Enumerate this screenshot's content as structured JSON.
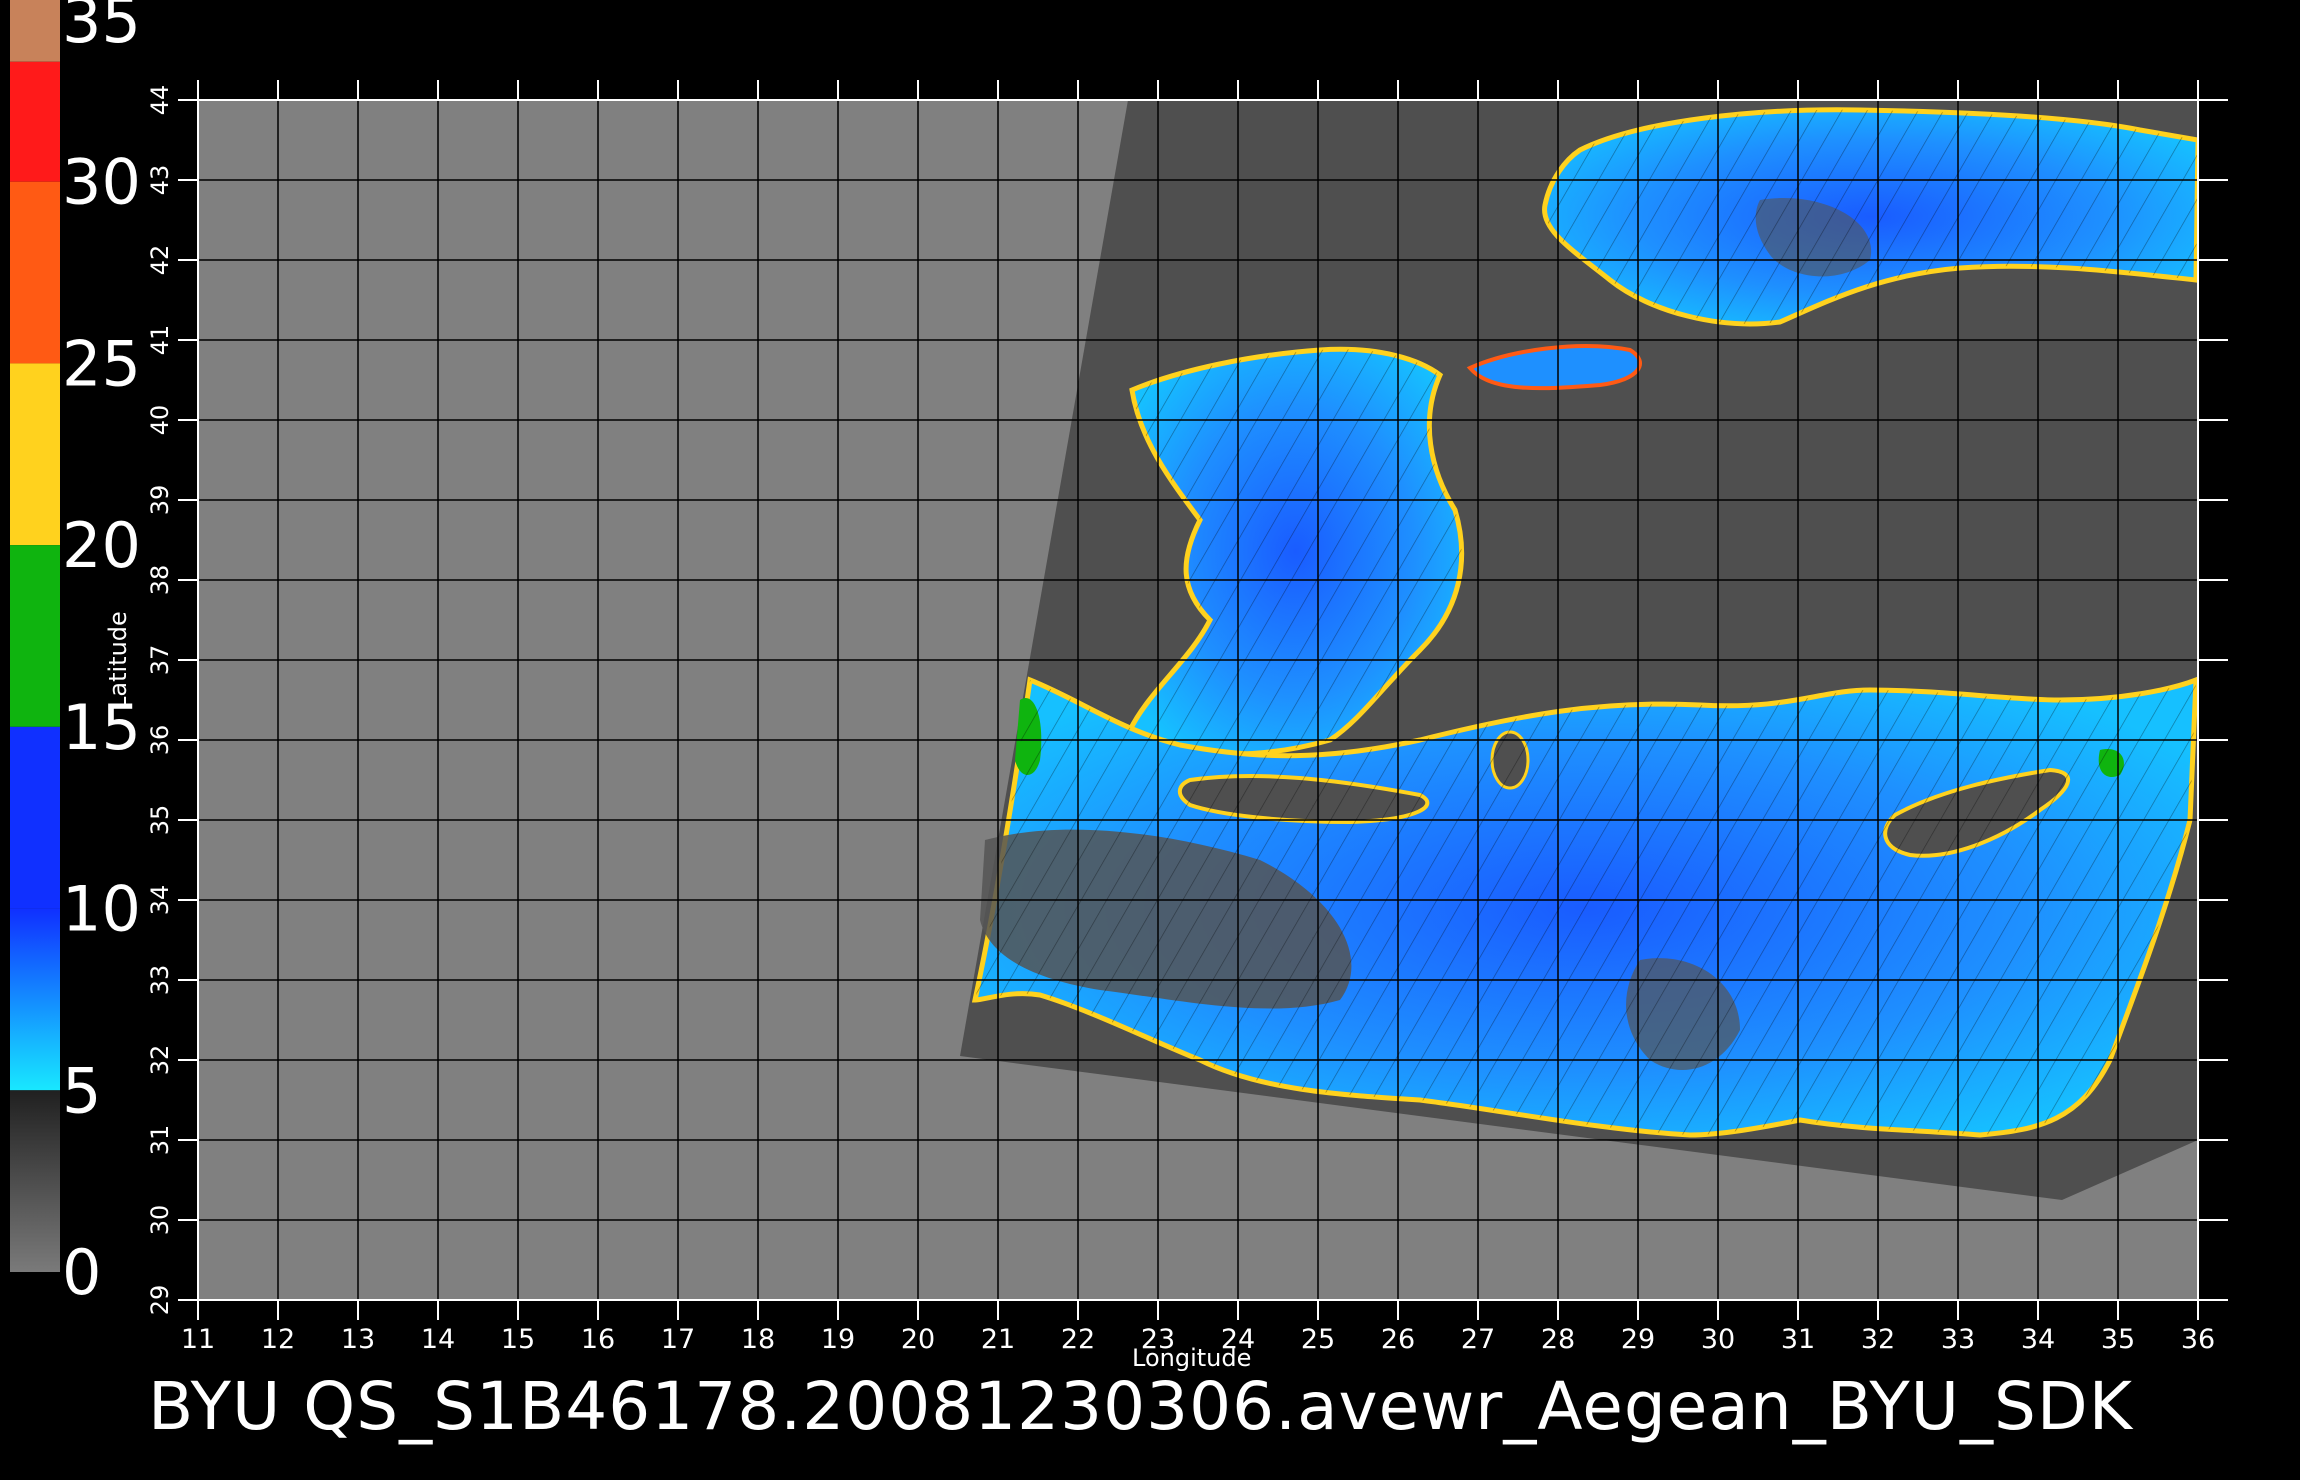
{
  "colorbar": {
    "labels": [
      "35",
      "30",
      "25",
      "20",
      "15",
      "10",
      "5",
      "0"
    ],
    "segments": [
      {
        "from": 35,
        "to": 33.3,
        "color": "#c8825a"
      },
      {
        "from": 33.3,
        "to": 30,
        "color": "#ff1a1a"
      },
      {
        "from": 30,
        "to": 25,
        "color": "#ff5a14"
      },
      {
        "from": 25,
        "to": 20,
        "color": "#ffd21e"
      },
      {
        "from": 20,
        "to": 15,
        "color": "#0fb40f"
      },
      {
        "from": 15,
        "to": 10,
        "color": "#1030ff"
      },
      {
        "from": 10,
        "to": 5,
        "color": "#18c8ff"
      },
      {
        "from": 5,
        "to": 0,
        "color": "#505050"
      }
    ]
  },
  "map": {
    "xlabel": "Longitude",
    "ylabel": "Latitude",
    "lon_ticks": [
      "11",
      "12",
      "13",
      "14",
      "15",
      "16",
      "17",
      "18",
      "19",
      "20",
      "21",
      "22",
      "23",
      "24",
      "25",
      "26",
      "27",
      "28",
      "29",
      "30",
      "31",
      "32",
      "33",
      "34",
      "35",
      "36"
    ],
    "lat_ticks": [
      "29",
      "30",
      "31",
      "32",
      "33",
      "34",
      "35",
      "36",
      "37",
      "38",
      "39",
      "40",
      "41",
      "42",
      "43",
      "44"
    ],
    "lon_range": [
      11,
      36
    ],
    "lat_range": [
      29,
      44
    ],
    "colors": {
      "background": "#808080",
      "swath": "#4f4f4f",
      "sea_low": "#1e90ff",
      "sea_high": "#0f3cff",
      "gridline": "#000000"
    }
  },
  "footer": {
    "title": "BYU  QS_S1B46178.20081230306.avewr_Aegean_BYU_SDK"
  }
}
